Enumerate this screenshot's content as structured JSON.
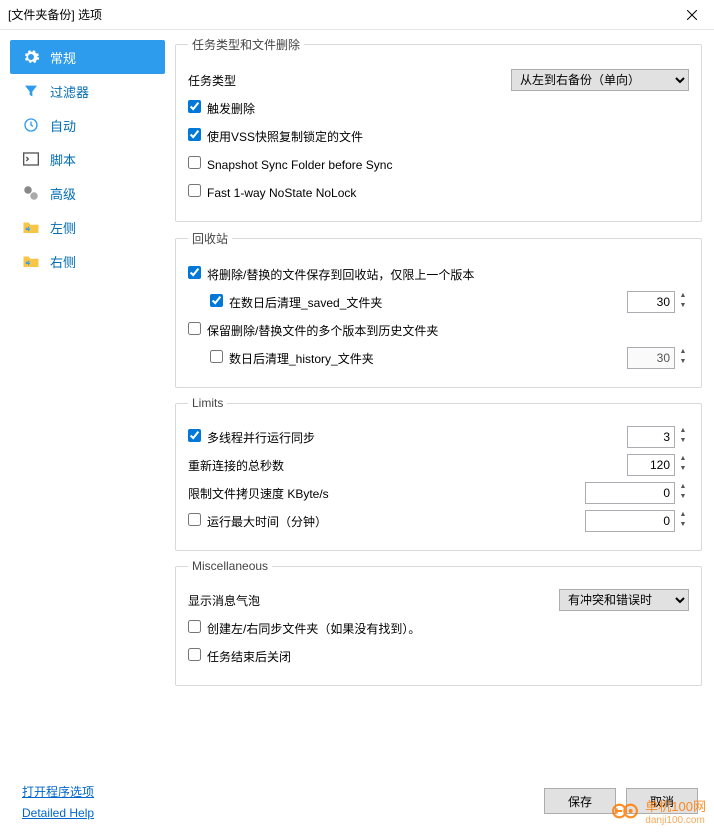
{
  "window": {
    "title": "[文件夹备份] 选项"
  },
  "sidebar": {
    "items": [
      {
        "label": "常规"
      },
      {
        "label": "过滤器"
      },
      {
        "label": "自动"
      },
      {
        "label": "脚本"
      },
      {
        "label": "高级"
      },
      {
        "label": "左侧"
      },
      {
        "label": "右侧"
      }
    ]
  },
  "sections": {
    "task": {
      "legend": "任务类型和文件删除",
      "task_type_label": "任务类型",
      "task_type_value": "从左到右备份（单向）",
      "cb_trigger_delete": "触发删除",
      "cb_vss": "使用VSS快照复制锁定的文件",
      "cb_snapshot": "Snapshot Sync Folder before Sync",
      "cb_fast1way": "Fast 1-way NoState NoLock"
    },
    "recycle": {
      "legend": "回收站",
      "cb_save_replaced": "将删除/替换的文件保存到回收站，仅限上一个版本",
      "cb_clean_saved": "在数日后清理_saved_文件夹",
      "val_saved_days": "30",
      "cb_keep_history": "保留删除/替换文件的多个版本到历史文件夹",
      "cb_clean_history": "数日后清理_history_文件夹",
      "val_history_days": "30"
    },
    "limits": {
      "legend": "Limits",
      "cb_threads": "多线程并行运行同步",
      "val_threads": "3",
      "lbl_reconnect": "重新连接的总秒数",
      "val_reconnect": "120",
      "lbl_speed": "限制文件拷贝速度 KByte/s",
      "val_speed": "0",
      "cb_maxtime": "运行最大时间（分钟）",
      "val_maxtime": "0"
    },
    "misc": {
      "legend": "Miscellaneous",
      "lbl_balloon": "显示消息气泡",
      "val_balloon": "有冲突和错误时",
      "cb_create_folders": "创建左/右同步文件夹（如果没有找到）。",
      "cb_close_after": "任务结束后关闭"
    }
  },
  "footer": {
    "link_program": "打开程序选项",
    "link_help": "Detailed Help",
    "btn_save": "保存",
    "btn_cancel": "取消"
  },
  "watermark": {
    "text": "单机100网",
    "url": "danji100.com"
  }
}
